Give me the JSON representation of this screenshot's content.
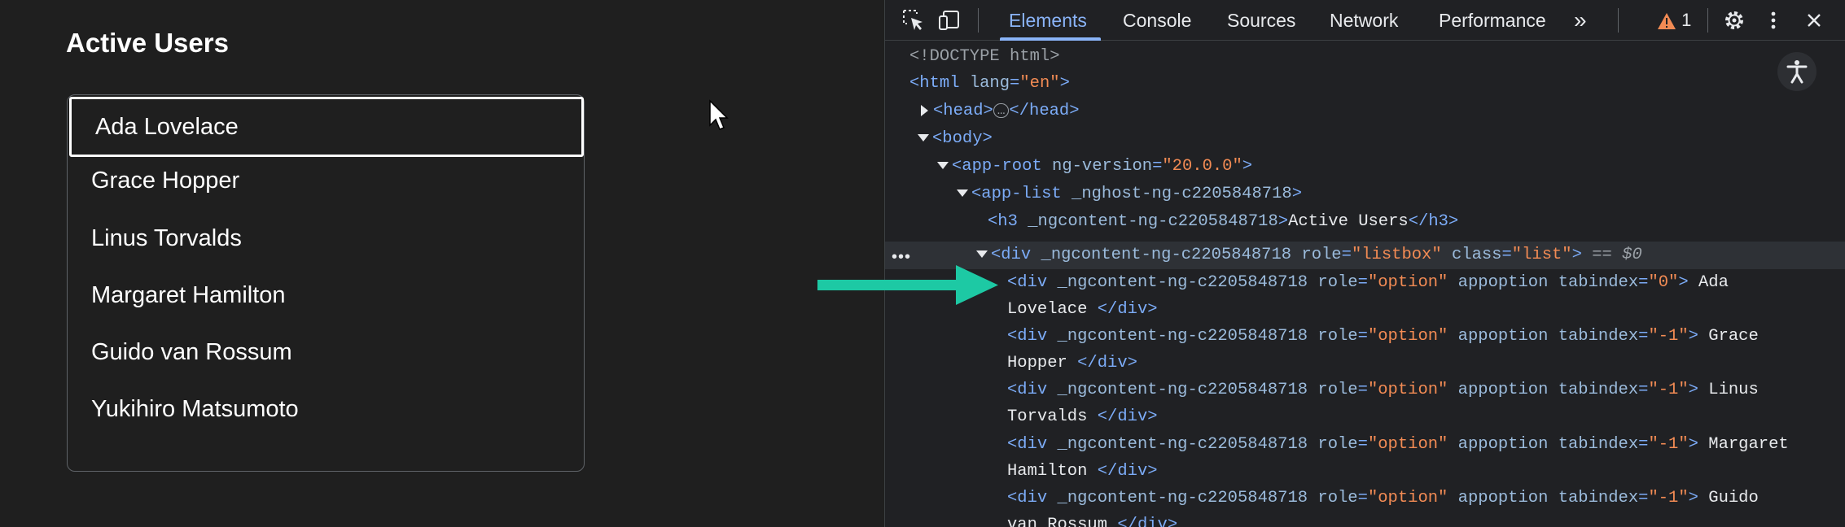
{
  "app": {
    "heading": "Active Users",
    "options": [
      "Ada Lovelace",
      "Grace Hopper",
      "Linus Torvalds",
      "Margaret Hamilton",
      "Guido van Rossum",
      "Yukihiro Matsumoto"
    ]
  },
  "devtools": {
    "tabs": [
      "Elements",
      "Console",
      "Sources",
      "Network",
      "Performance"
    ],
    "more_tabs": "»",
    "warning_count": "1",
    "dom": {
      "doctype": "<!DOCTYPE html>",
      "html_open": "<html",
      "html_lang_attr": "lang",
      "html_lang_val": "\"en\"",
      "head_open": "<head>",
      "head_ellipsis": "…",
      "head_close": "</head>",
      "body_open": "<body>",
      "approot_tag": "<app-root",
      "approot_attr": "ng-version",
      "approot_val": "\"20.0.0\"",
      "applist_tag": "<app-list",
      "applist_attr": "_nghost-ng-c2205848718",
      "h3_tag": "<h3",
      "h3_attr": "_ngcontent-ng-c2205848718",
      "h3_text": "Active Users",
      "h3_close": "</h3>",
      "div_tag": "<div",
      "div_attr": "_ngcontent-ng-c2205848718",
      "role_attr": "role",
      "listbox_val": "\"listbox\"",
      "class_attr": "class",
      "class_val": "\"list\"",
      "eq_label": "== $0",
      "option_val": "\"option\"",
      "appoption_attr": "appoption",
      "tabindex_attr": "tabindex",
      "tabindex_0": "\"0\"",
      "tabindex_neg": "\"-1\"",
      "div_close": "</div>",
      "children": [
        {
          "tab": "\"0\"",
          "t1": "Ada",
          "t2": "Lovelace"
        },
        {
          "tab": "\"-1\"",
          "t1": "Grace",
          "t2": "Hopper"
        },
        {
          "tab": "\"-1\"",
          "t1": "Linus",
          "t2": "Torvalds"
        },
        {
          "tab": "\"-1\"",
          "t1": "Margaret",
          "t2": "Hamilton"
        },
        {
          "tab": "\"-1\"",
          "t1": "Guido",
          "t2": "van Rossum"
        }
      ]
    }
  },
  "colors": {
    "accent": "#8ab4f8",
    "arrow": "#1dc9a4",
    "warning": "#f28b54"
  }
}
